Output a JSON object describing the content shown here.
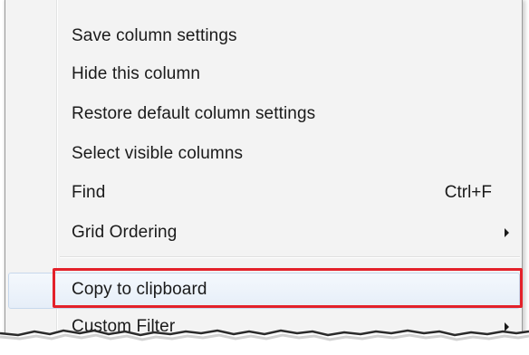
{
  "menu": {
    "items": [
      {
        "label": "Save column settings"
      },
      {
        "label": "Hide this column"
      },
      {
        "label": "Restore default column settings"
      },
      {
        "label": "Select visible columns"
      },
      {
        "label": "Find",
        "shortcut": "Ctrl+F"
      },
      {
        "label": "Grid Ordering",
        "submenu": true
      },
      {
        "label": "Copy to clipboard",
        "hovered": true,
        "highlighted": true
      },
      {
        "label": "Custom Filter",
        "submenu": true
      }
    ]
  },
  "colors": {
    "menu_background": "#f3f3f3",
    "hover_background": "#e6eef8",
    "hover_border": "#c7d8ec",
    "highlight_annotation": "#e3212a",
    "text": "#1a1a1a"
  },
  "icons": {
    "submenu": "submenu-arrow-icon"
  }
}
